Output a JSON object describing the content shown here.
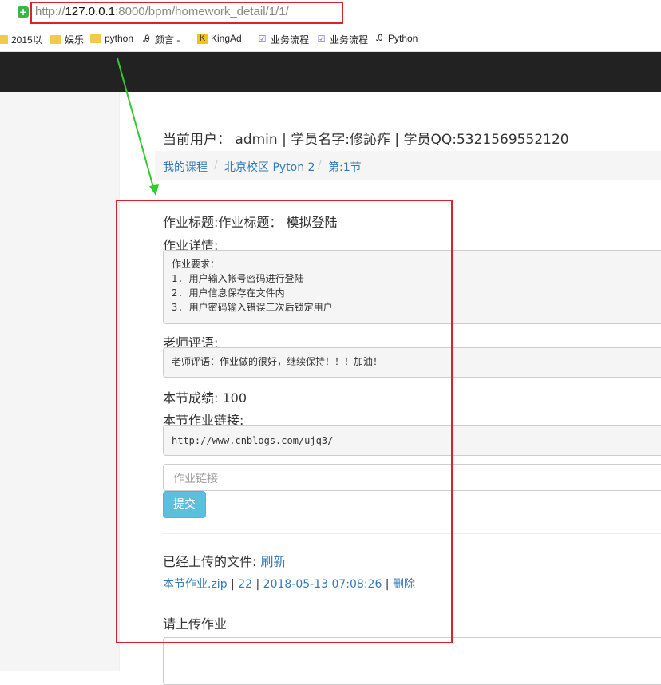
{
  "browser": {
    "url_prefix": "http://",
    "url_host": "127.0.0.1",
    "url_path": ":8000/bpm/homework_detail/1/1/"
  },
  "bookmarks": [
    {
      "label": "2015以",
      "icon": "folder-icon"
    },
    {
      "label": "娱乐",
      "icon": "folder-icon"
    },
    {
      "label": "python",
      "icon": "folder-icon"
    },
    {
      "label": "颜言 -",
      "icon": "site-icon"
    },
    {
      "label": "KingAd",
      "icon": "site-icon"
    },
    {
      "label": "业务流程",
      "icon": "site-icon"
    },
    {
      "label": "业务流程",
      "icon": "site-icon"
    },
    {
      "label": "Python",
      "icon": "site-icon"
    }
  ],
  "user": {
    "label": "当前用户：",
    "name": "admin",
    "rest": " | 学员名字:修訫痄 | 学员QQ:5321569552120"
  },
  "breadcrumb": {
    "items": [
      "我的课程",
      "北京校区 Pyton 2",
      "第:1节"
    ],
    "sep": "/"
  },
  "homework": {
    "title_label": "作业标题:作业标题：",
    "title_value": "模拟登陆",
    "detail_label": "作业详情:",
    "detail_text": "作业要求：\n1. 用户输入帐号密码进行登陆\n2. 用户信息保存在文件内\n3. 用户密码输入错误三次后锁定用户",
    "comment_label": "老师评语:",
    "comment_text": "老师评语：作业做的很好，继续保持！！！加油！",
    "score_label": "本节成绩:",
    "score_value": "100",
    "link_label": "本节作业链接:",
    "link_text": "http://www.cnblogs.com/ujq3/",
    "input_placeholder": "作业链接",
    "submit_label": "提交"
  },
  "uploaded": {
    "label": "已经上传的文件:",
    "refresh": "刷新",
    "file_name": "本节作业.zip",
    "file_size": "22",
    "file_time": "2018-05-13 07:08:26",
    "delete": "删除",
    "sep": " | "
  },
  "upload": {
    "label": "请上传作业"
  },
  "annotation_colors": {
    "box": "#d8232a",
    "arrow": "#2ecc2e"
  }
}
